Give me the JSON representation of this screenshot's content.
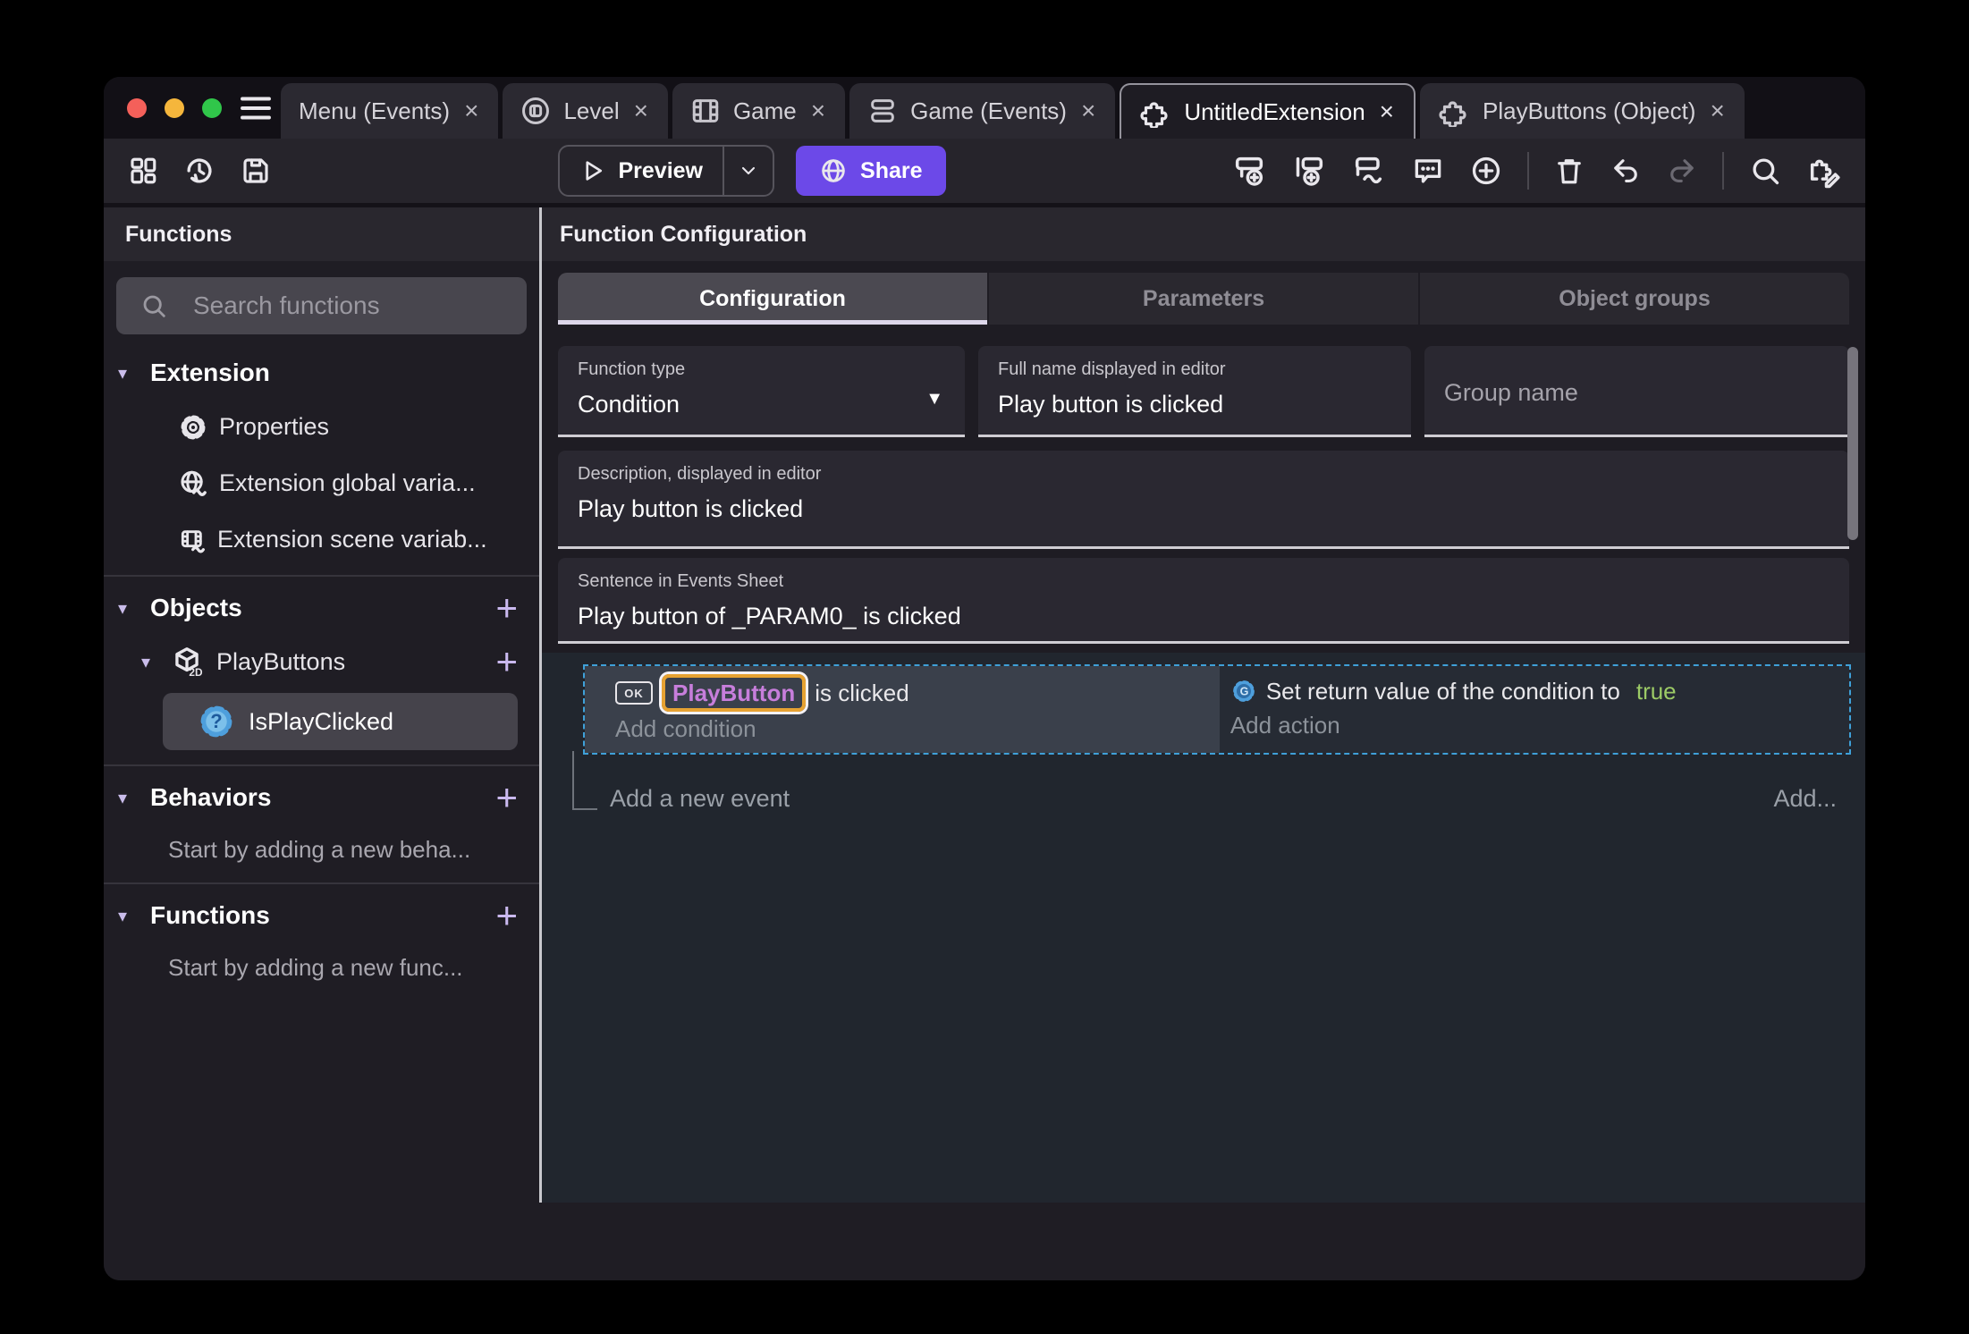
{
  "colors": {
    "accent_purple": "#6C49E8",
    "selection_dashed_blue": "#3FA0D8",
    "chip_border_orange": "#E6A232",
    "chip_text_purple": "#C77EDB",
    "true_green": "#9CCB66",
    "active_tab_underline": "#DDD7EA",
    "condition_bg": "#3A404B",
    "action_bg": "#262B34"
  },
  "glyphs": {
    "close": "×",
    "plus": "+",
    "triangle_down": "▾",
    "dropdown_arrow": "▼"
  },
  "tabbar": {
    "tabs": [
      {
        "label": "Menu (Events)",
        "icon": "none"
      },
      {
        "label": "Level",
        "icon": "level-icon"
      },
      {
        "label": "Game",
        "icon": "film-icon"
      },
      {
        "label": "Game (Events)",
        "icon": "events-sheet-icon"
      },
      {
        "label": "UntitledExtension",
        "icon": "puzzle-icon",
        "active": true
      },
      {
        "label": "PlayButtons (Object)",
        "icon": "puzzle-icon"
      }
    ]
  },
  "toolbar": {
    "preview_label": "Preview",
    "share_label": "Share",
    "left_icons": [
      "layout-panels-icon",
      "history-icon",
      "save-icon"
    ],
    "right_icons": [
      "add-event-icon",
      "add-subevent-icon",
      "add-other-event-icon",
      "add-comment-icon",
      "add-circle-icon",
      "trash-icon",
      "undo-icon",
      "redo-icon",
      "search-icon",
      "edit-extension-icon"
    ]
  },
  "sidebar": {
    "header": "Functions",
    "search_placeholder": "Search functions",
    "extension": {
      "title": "Extension",
      "items": [
        {
          "label": "Properties",
          "icon": "gear-icon"
        },
        {
          "label": "Extension global varia...",
          "icon": "global-variables-icon"
        },
        {
          "label": "Extension scene variab...",
          "icon": "scene-variables-icon"
        }
      ]
    },
    "objects": {
      "title": "Objects",
      "object": {
        "label": "PlayButtons",
        "icon": "object-2d-cube-icon"
      },
      "selected_function": {
        "label": "IsPlayClicked",
        "icon": "condition-gear-icon"
      }
    },
    "behaviors": {
      "title": "Behaviors",
      "empty": "Start by adding a new beha..."
    },
    "functions": {
      "title": "Functions",
      "empty": "Start by adding a new func..."
    }
  },
  "main": {
    "header": "Function Configuration",
    "tabs": [
      {
        "label": "Configuration",
        "active": true
      },
      {
        "label": "Parameters",
        "active": false
      },
      {
        "label": "Object groups",
        "active": false
      }
    ],
    "form": {
      "function_type": {
        "label": "Function type",
        "value": "Condition"
      },
      "full_name": {
        "label": "Full name displayed in editor",
        "value": "Play button is clicked"
      },
      "group_name": {
        "placeholder": "Group name"
      },
      "description": {
        "label": "Description, displayed in editor",
        "value": "Play button is clicked"
      },
      "sentence": {
        "label": "Sentence in Events Sheet",
        "value": "Play button of _PARAM0_ is clicked"
      }
    },
    "events": {
      "condition": {
        "object_icon_label": "OK",
        "object_name": "PlayButton",
        "text": "is clicked",
        "add_label": "Add condition"
      },
      "action": {
        "text": "Set return value of the condition to",
        "value": "true",
        "add_label": "Add action"
      },
      "add_new_event": "Add a new event",
      "add_button": "Add..."
    }
  }
}
